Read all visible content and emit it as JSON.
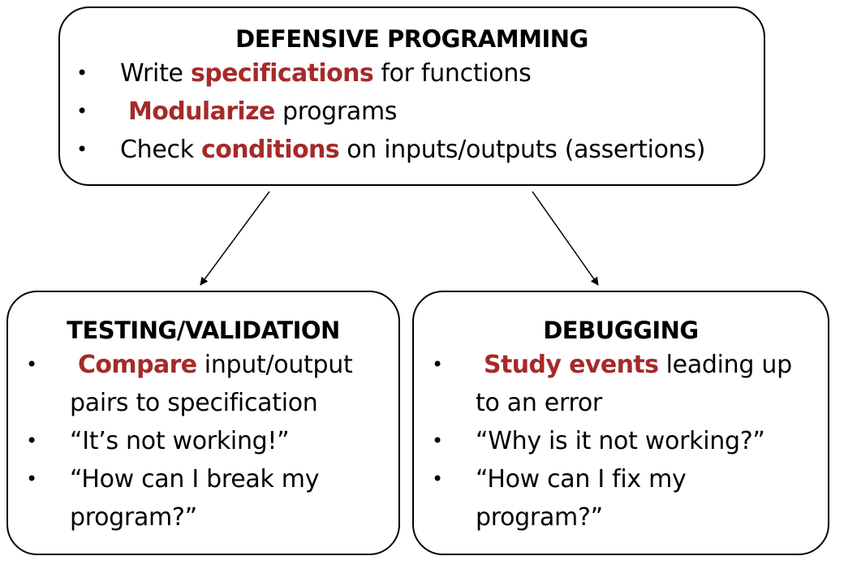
{
  "defensive": {
    "title": "DEFENSIVE PROGRAMMING",
    "items": [
      {
        "pre": "Write ",
        "hl": "specifications",
        "post": " for functions"
      },
      {
        "pre": "",
        "hl": "Modularize",
        "post": " programs"
      },
      {
        "pre": "Check ",
        "hl": "conditions",
        "post": " on inputs/outputs (assertions)"
      }
    ]
  },
  "testing": {
    "title": "TESTING/VALIDATION",
    "items": [
      {
        "hl": "Compare",
        "post": " input/output",
        "cont": "pairs to specification"
      },
      {
        "text": "“It’s not working!”"
      },
      {
        "text": "“How can I break my",
        "cont": "program?”"
      }
    ]
  },
  "debugging": {
    "title": "DEBUGGING",
    "items": [
      {
        "hl": "Study events",
        "post": " leading up",
        "cont": "to an error"
      },
      {
        "text": "“Why is it not working?”"
      },
      {
        "text": "“How can I fix my",
        "cont": "program?”"
      }
    ]
  },
  "bullet_glyph": "•",
  "colors": {
    "highlight": "#a52a2a",
    "border": "#000000",
    "text": "#000000"
  }
}
